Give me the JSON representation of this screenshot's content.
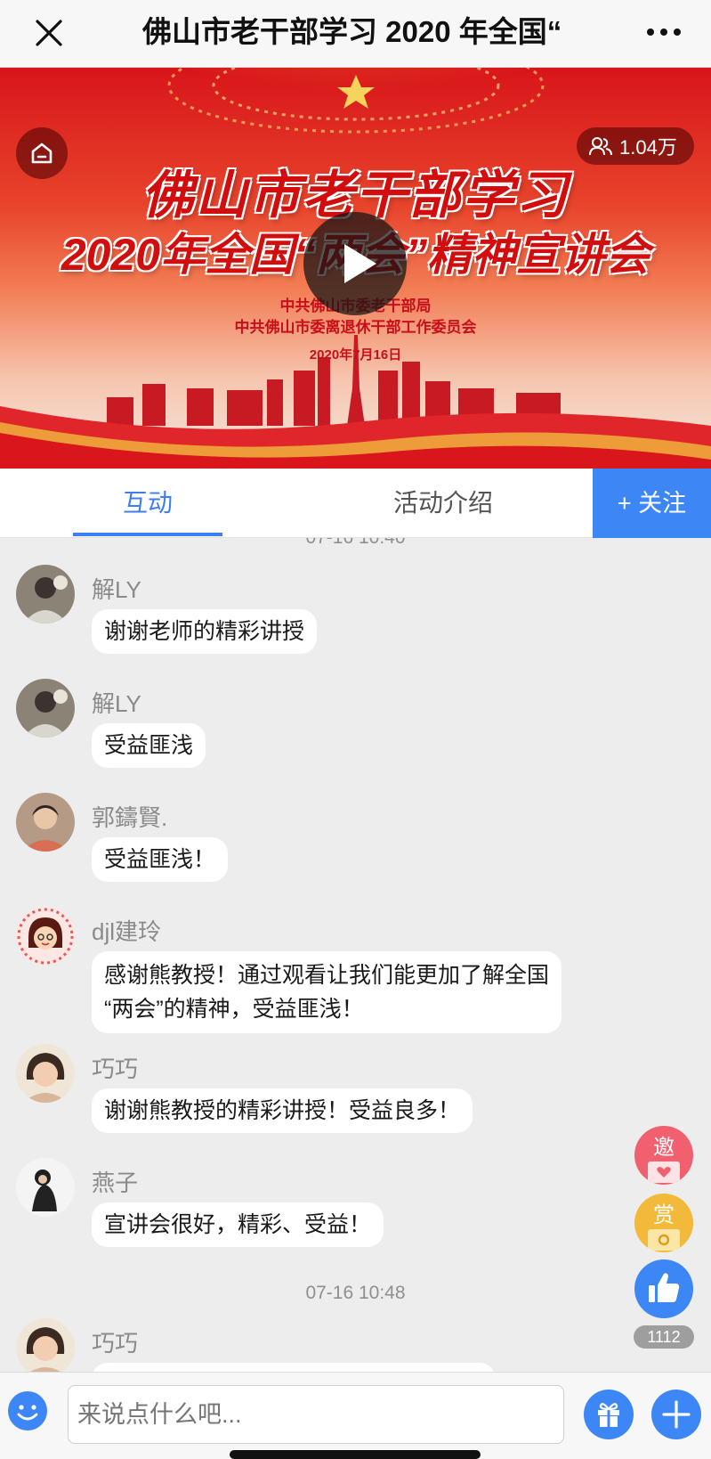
{
  "header": {
    "title": "佛山市老干部学习 2020 年全国“"
  },
  "banner": {
    "title_line1": "佛山市老干部学习",
    "title_line2": "2020年全国“两会”精神宣讲会",
    "org_line1": "中共佛山市委老干部局",
    "org_line2": "中共佛山市委离退休干部工作委员会",
    "date": "2020年7月16日",
    "viewer_count": "1.04万"
  },
  "tabs": [
    {
      "label": "互动"
    },
    {
      "label": "活动介绍"
    }
  ],
  "follow_label": "+ 关注",
  "chat": {
    "dividers": [
      "07-16 10:40",
      "07-16 10:48"
    ],
    "messages": [
      {
        "user": "解LY",
        "text": "谢谢老师的精彩讲授"
      },
      {
        "user": "解LY",
        "text": "受益匪浅"
      },
      {
        "user": "郭鑄賢.",
        "text": "受益匪浅！"
      },
      {
        "user": "djl建玲",
        "text_line1": "感谢熊教授！通过观看让我们能更加了解全国",
        "text_line2": "“两会”的精神，受益匪浅！"
      },
      {
        "user": "巧巧",
        "text": "谢谢熊教授的精彩讲授！受益良多！"
      },
      {
        "user": "燕子",
        "text": "宣讲会很好，精彩、受益！"
      },
      {
        "user": "巧巧",
        "text": ""
      }
    ]
  },
  "side_buttons": {
    "invite_label": "邀",
    "reward_label": "赏",
    "like_count": "1112"
  },
  "composer": {
    "placeholder": "来说点什么吧..."
  },
  "colors": {
    "accent": "#3d7ff2",
    "follow_bg": "#3d86f6",
    "banner_red": "#d10d0d"
  }
}
